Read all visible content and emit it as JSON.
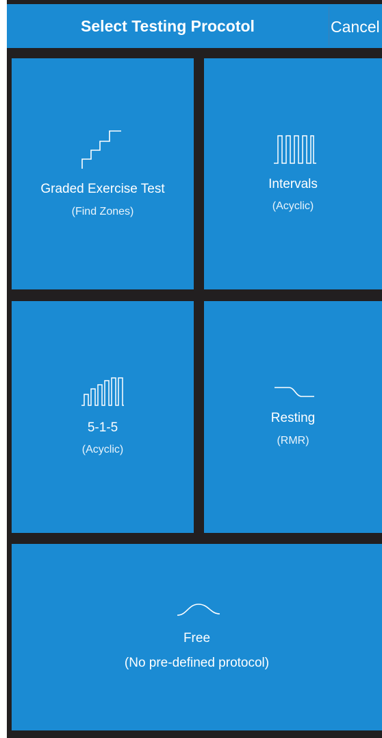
{
  "header": {
    "title": "Select Testing Procotol",
    "cancel_label": "Cancel"
  },
  "protocols": [
    {
      "label": "Graded Exercise Test",
      "sublabel": "(Find Zones)",
      "icon": "staircase-icon"
    },
    {
      "label": "Intervals",
      "sublabel": "(Acyclic)",
      "icon": "square-wave-icon"
    },
    {
      "label": "5-1-5",
      "sublabel": "(Acyclic)",
      "icon": "rising-pulses-icon"
    },
    {
      "label": "Resting",
      "sublabel": "(RMR)",
      "icon": "descending-curve-icon"
    },
    {
      "label": "Free",
      "sublabel": "(No pre-defined protocol)",
      "icon": "wave-curve-icon"
    }
  ],
  "colors": {
    "tile": "#1b8bd3",
    "background": "#221f20",
    "text": "#ffffff"
  }
}
